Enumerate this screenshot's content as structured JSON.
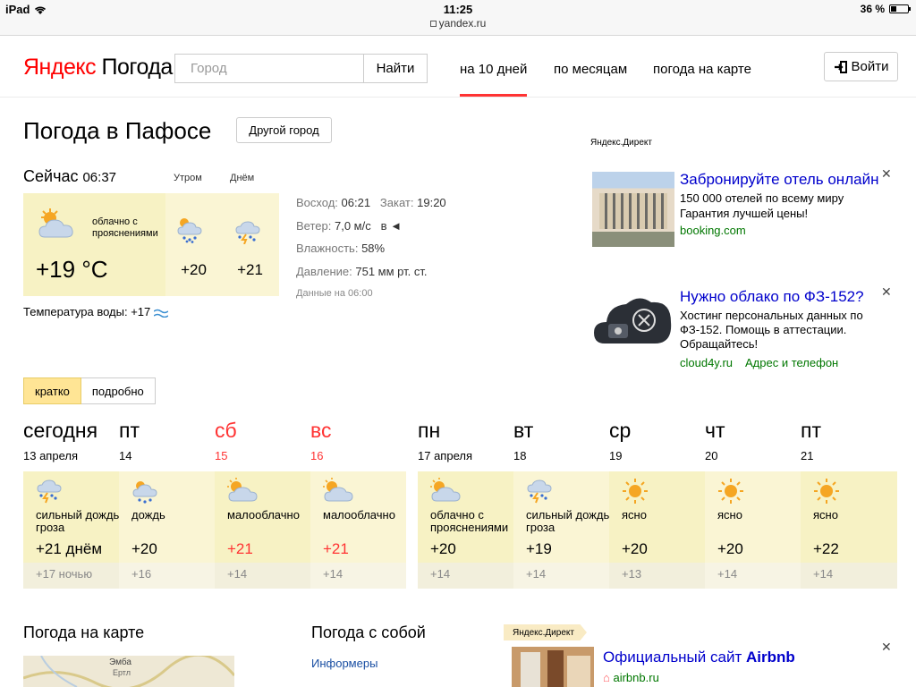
{
  "statusbar": {
    "device": "iPad",
    "time": "11:25",
    "url": "yandex.ru",
    "battery": "36 %"
  },
  "header": {
    "logo_brand": "Яндекс",
    "logo_service": "Погода",
    "search_placeholder": "Город",
    "search_button": "Найти",
    "nav": [
      {
        "label": "на 10 дней",
        "active": true
      },
      {
        "label": "по месяцам",
        "active": false
      },
      {
        "label": "погода на карте",
        "active": false
      }
    ],
    "login": "Войти"
  },
  "title": "Погода в Пафосе",
  "other_city": "Другой город",
  "now": {
    "label": "Сейчас",
    "time": "06:37",
    "condition": "облачно с прояснениями",
    "temp": "+19 °C",
    "morning": {
      "label": "Утром",
      "temp": "+20"
    },
    "day": {
      "label": "Днём",
      "temp": "+21"
    },
    "sunrise_label": "Восход:",
    "sunrise": "06:21",
    "sunset_label": "Закат:",
    "sunset": "19:20",
    "wind_label": "Ветер:",
    "wind": "7,0 м/с",
    "wind_dir": "в",
    "humidity_label": "Влажность:",
    "humidity": "58%",
    "pressure_label": "Давление:",
    "pressure": "751 мм рт. ст.",
    "data_at": "Данные на 06:00",
    "water": "Температура воды: +17"
  },
  "view_tabs": [
    "кратко",
    "подробно"
  ],
  "days": [
    {
      "name": "сегодня",
      "date": "13 апреля",
      "cond": "сильный дождь, гроза",
      "temp": "+21 днём",
      "night": "+17 ночью",
      "weekend": false,
      "icon": "cloud-rain-storm-icon"
    },
    {
      "name": "пт",
      "date": "14",
      "cond": "дождь",
      "temp": "+20",
      "night": "+16",
      "weekend": false,
      "icon": "sun-cloud-rain-icon"
    },
    {
      "name": "сб",
      "date": "15",
      "cond": "малооблачно",
      "temp": "+21",
      "night": "+14",
      "weekend": true,
      "icon": "sun-cloud-icon"
    },
    {
      "name": "вс",
      "date": "16",
      "cond": "малооблачно",
      "temp": "+21",
      "night": "+14",
      "weekend": true,
      "icon": "sun-cloud-icon"
    },
    {
      "name": "пн",
      "date": "17 апреля",
      "cond": "облачно с прояснениями",
      "temp": "+20",
      "night": "+14",
      "weekend": false,
      "icon": "sun-cloud-icon"
    },
    {
      "name": "вт",
      "date": "18",
      "cond": "сильный дождь, гроза",
      "temp": "+19",
      "night": "+14",
      "weekend": false,
      "icon": "cloud-rain-storm-icon"
    },
    {
      "name": "ср",
      "date": "19",
      "cond": "ясно",
      "temp": "+20",
      "night": "+13",
      "weekend": false,
      "icon": "sun-icon"
    },
    {
      "name": "чт",
      "date": "20",
      "cond": "ясно",
      "temp": "+20",
      "night": "+14",
      "weekend": false,
      "icon": "sun-icon"
    },
    {
      "name": "пт",
      "date": "21",
      "cond": "ясно",
      "temp": "+22",
      "night": "+14",
      "weekend": false,
      "icon": "sun-icon"
    }
  ],
  "ads": {
    "label": "Яндекс.Директ",
    "items": [
      {
        "title": "Забронируйте отель онлайн",
        "text1": "150 000 отелей по всему миру",
        "text2": "Гарантия лучшей цены!",
        "link": "booking.com"
      },
      {
        "title": "Нужно облако по ФЗ-152?",
        "text1": "Хостинг персональных данных по",
        "text2": "ФЗ-152. Помощь в аттестации.",
        "text3": "Обращайтесь!",
        "link": "cloud4y.ru",
        "link2": "Адрес и телефон"
      }
    ]
  },
  "bottom": {
    "map_title": "Погода на карте",
    "map_label1": "Эмба",
    "map_label2": "Ертл",
    "widgets_title": "Погода с собой",
    "informers": "Информеры",
    "ad_tag": "Яндекс.Директ",
    "airbnb_title_prefix": "Официальный сайт ",
    "airbnb_title_brand": "Airbnb",
    "airbnb_link": "airbnb.ru"
  },
  "colors": {
    "accent_red": "#ff3333",
    "link_blue": "#0000cc",
    "link_green": "#007700",
    "day_bg": "#faf5d4",
    "now_bg": "#f7f2c4"
  }
}
